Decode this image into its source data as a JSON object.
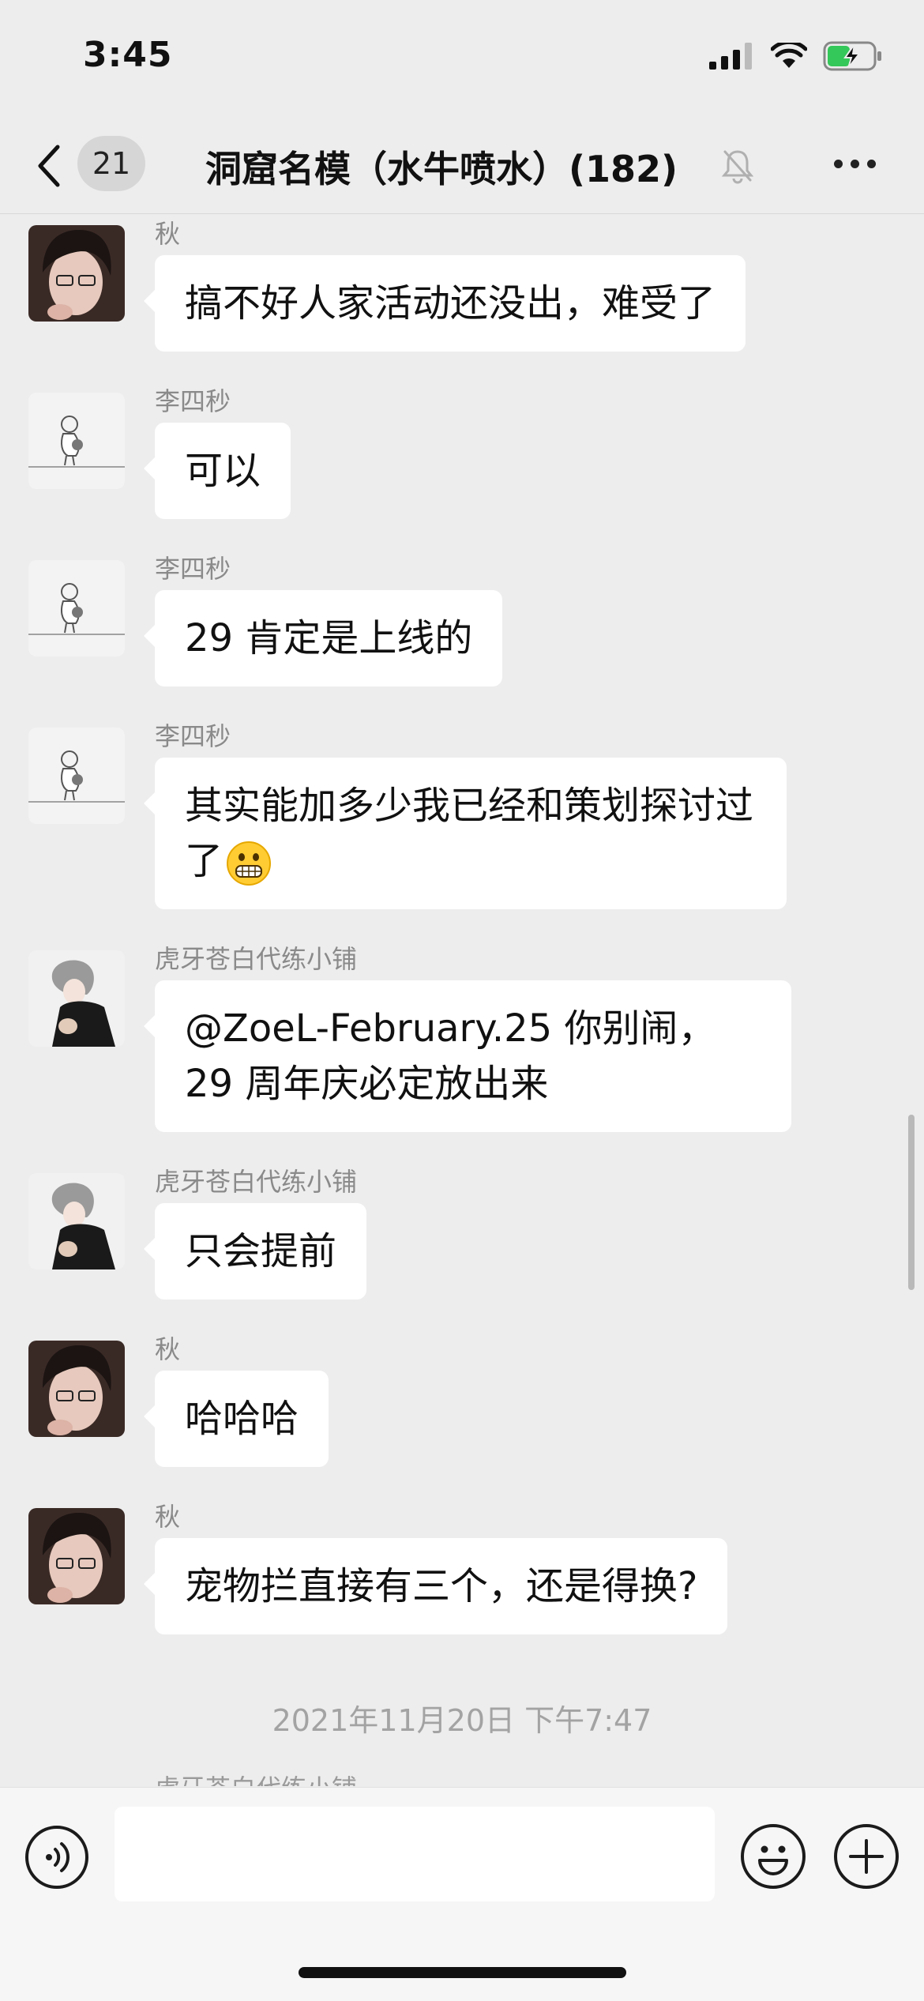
{
  "status_bar": {
    "time": "3:45"
  },
  "header": {
    "unread_count": "21",
    "title": "洞窟名模（水牛喷水）(182)"
  },
  "messages": [
    {
      "sender": "秋",
      "text": "搞不好人家活动还没出，难受了",
      "avatar": "avatar-qiu"
    },
    {
      "sender": "李四秒",
      "text": "可以",
      "avatar": "avatar-lisimiao"
    },
    {
      "sender": "李四秒",
      "text": "29 肯定是上线的",
      "avatar": "avatar-lisimiao"
    },
    {
      "sender": "李四秒",
      "text": "其实能加多少我已经和策划探讨过了",
      "emoji": "grimacing-emoji",
      "avatar": "avatar-lisimiao"
    },
    {
      "sender": "虎牙苍白代练小铺",
      "text": "@ZoeL-February.25 你别闹， 29 周年庆必定放出来",
      "avatar": "avatar-huya"
    },
    {
      "sender": "虎牙苍白代练小铺",
      "text": "只会提前",
      "avatar": "avatar-huya"
    },
    {
      "sender": "秋",
      "text": "哈哈哈",
      "avatar": "avatar-qiu"
    },
    {
      "sender": "秋",
      "text": "宠物拦直接有三个，还是得换?",
      "avatar": "avatar-qiu"
    }
  ],
  "timestamp": "2021年11月20日 下午7:47",
  "cut_off_sender": "虎牙苍白代练小铺",
  "input": {
    "value": "",
    "placeholder": ""
  },
  "colors": {
    "background": "#ededed",
    "bubble": "#ffffff",
    "sender_text": "#8a8a8a",
    "timestamp_text": "#a3a3a3"
  }
}
